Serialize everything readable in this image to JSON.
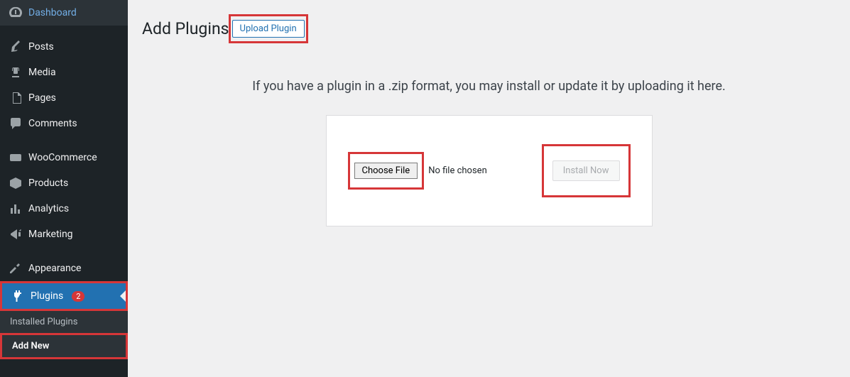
{
  "sidebar": {
    "items": [
      {
        "label": "Dashboard"
      },
      {
        "label": "Posts"
      },
      {
        "label": "Media"
      },
      {
        "label": "Pages"
      },
      {
        "label": "Comments"
      },
      {
        "label": "WooCommerce"
      },
      {
        "label": "Products"
      },
      {
        "label": "Analytics"
      },
      {
        "label": "Marketing"
      },
      {
        "label": "Appearance"
      },
      {
        "label": "Plugins",
        "badge": "2"
      }
    ],
    "submenu": {
      "installed": "Installed Plugins",
      "addnew": "Add New"
    }
  },
  "page": {
    "title": "Add Plugins",
    "upload_button": "Upload Plugin",
    "instruction": "If you have a plugin in a .zip format, you may install or update it by uploading it here.",
    "choose_file": "Choose File",
    "no_file": "No file chosen",
    "install": "Install Now"
  }
}
